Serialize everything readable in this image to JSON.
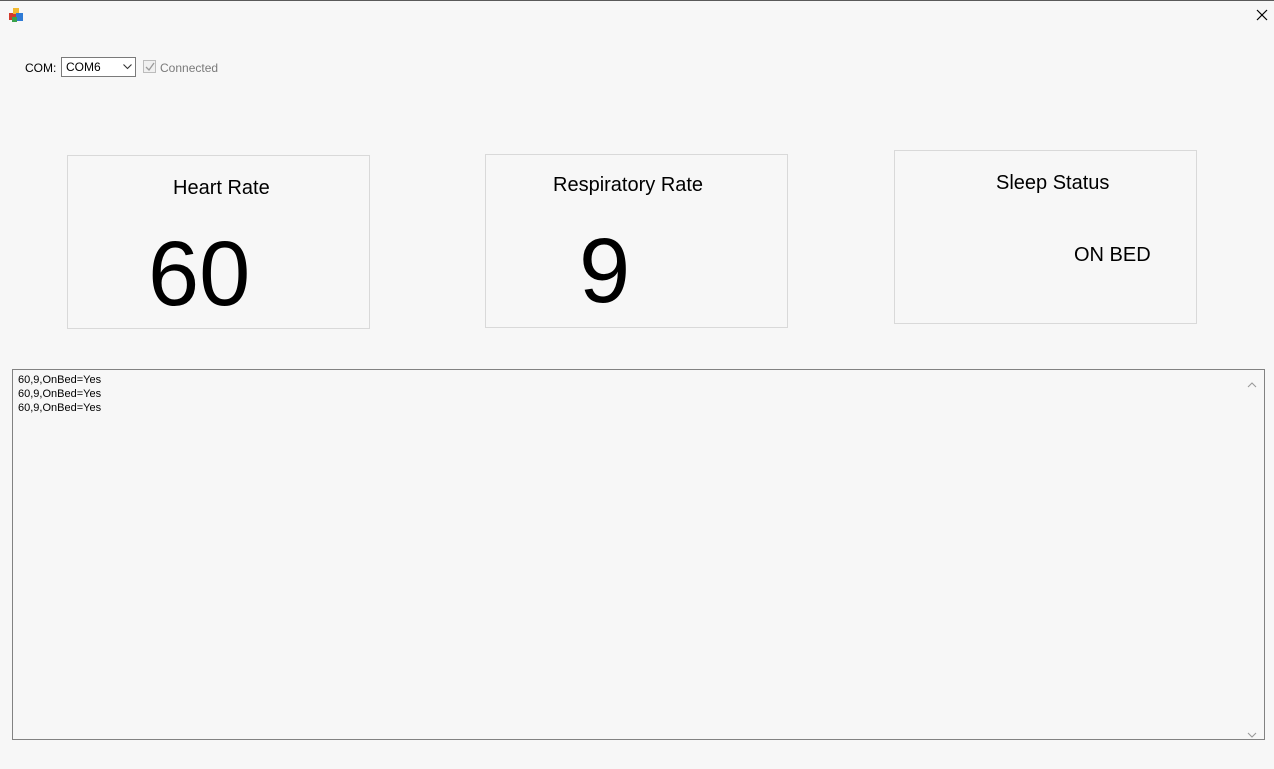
{
  "window": {
    "app_icon": "app-icon",
    "close_icon": "close-icon"
  },
  "connection": {
    "com_label": "COM:",
    "com_port_value": "COM6",
    "connected_label": "Connected",
    "connected_checked": true
  },
  "panels": {
    "heart_rate": {
      "title": "Heart Rate",
      "value": "60"
    },
    "respiratory_rate": {
      "title": "Respiratory Rate",
      "value": "9"
    },
    "sleep_status": {
      "title": "Sleep Status",
      "value": "ON BED"
    }
  },
  "log": {
    "lines": [
      "60,9,OnBed=Yes",
      "60,9,OnBed=Yes",
      "60,9,OnBed=Yes"
    ]
  }
}
